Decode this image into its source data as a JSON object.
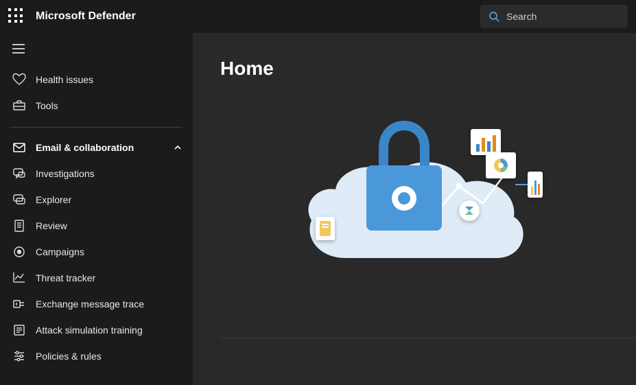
{
  "header": {
    "app_title": "Microsoft Defender",
    "search_placeholder": "Search"
  },
  "sidebar": {
    "group1": [
      {
        "label": "Health issues",
        "icon": "heart"
      },
      {
        "label": "Tools",
        "icon": "toolbox"
      }
    ],
    "section": {
      "label": "Email & collaboration",
      "icon": "mail",
      "expanded": true
    },
    "group2": [
      {
        "label": "Investigations",
        "icon": "chat"
      },
      {
        "label": "Explorer",
        "icon": "explorer"
      },
      {
        "label": "Review",
        "icon": "document"
      },
      {
        "label": "Campaigns",
        "icon": "target"
      },
      {
        "label": "Threat tracker",
        "icon": "chart-line"
      },
      {
        "label": "Exchange message trace",
        "icon": "exchange"
      },
      {
        "label": "Attack simulation training",
        "icon": "simulation"
      },
      {
        "label": "Policies & rules",
        "icon": "sliders"
      }
    ]
  },
  "main": {
    "page_title": "Home"
  }
}
